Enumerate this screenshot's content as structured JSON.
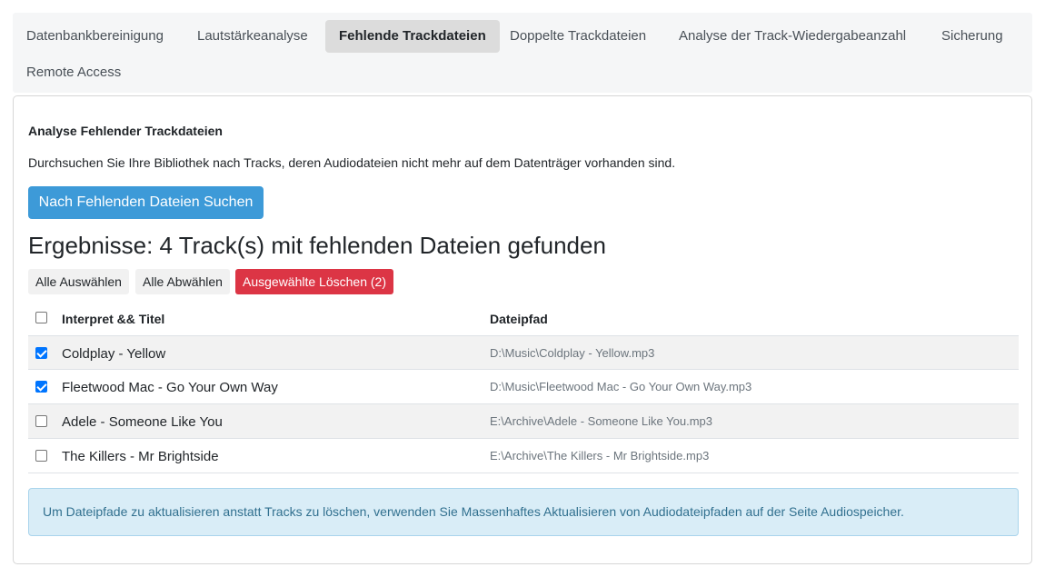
{
  "tabs": [
    {
      "label": "Datenbankbereinigung",
      "active": false
    },
    {
      "label": "Lautstärkeanalyse",
      "active": false
    },
    {
      "label": "Fehlende Trackdateien",
      "active": true
    },
    {
      "label": "Doppelte Trackdateien",
      "active": false
    },
    {
      "label": "Analyse der Track-Wiedergabeanzahl",
      "active": false
    },
    {
      "label": "Sicherung",
      "active": false
    },
    {
      "label": "Remote Access",
      "active": false
    }
  ],
  "card": {
    "title": "Analyse Fehlender Trackdateien",
    "description": "Durchsuchen Sie Ihre Bibliothek nach Tracks, deren Audiodateien nicht mehr auf dem Datenträger vorhanden sind.",
    "scan_button": "Nach Fehlenden Dateien Suchen",
    "results_heading": "Ergebnisse: 4 Track(s) mit fehlenden Dateien gefunden",
    "select_all": "Alle Auswählen",
    "deselect_all": "Alle Abwählen",
    "delete_selected": "Ausgewählte Löschen (2)"
  },
  "table": {
    "headers": {
      "title": "Interpret && Titel",
      "path": "Dateipfad"
    },
    "rows": [
      {
        "title": "Coldplay - Yellow",
        "path": "D:\\Music\\Coldplay - Yellow.mp3",
        "checked": true
      },
      {
        "title": "Fleetwood Mac - Go Your Own Way",
        "path": "D:\\Music\\Fleetwood Mac - Go Your Own Way.mp3",
        "checked": true
      },
      {
        "title": "Adele - Someone Like You",
        "path": "E:\\Archive\\Adele - Someone Like You.mp3",
        "checked": false
      },
      {
        "title": "The Killers - Mr Brightside",
        "path": "E:\\Archive\\The Killers - Mr Brightside.mp3",
        "checked": false
      }
    ]
  },
  "info_text": "Um Dateipfade zu aktualisieren anstatt Tracks zu löschen, verwenden Sie Massenhaftes Aktualisieren von Audiodateipfaden auf der Seite Audiospeicher.",
  "colors": {
    "primary": "#3d9ad8",
    "danger": "#dc3545",
    "info_bg": "#d9edf7",
    "info_text": "#31708f",
    "checkbox": "#0075ff"
  }
}
